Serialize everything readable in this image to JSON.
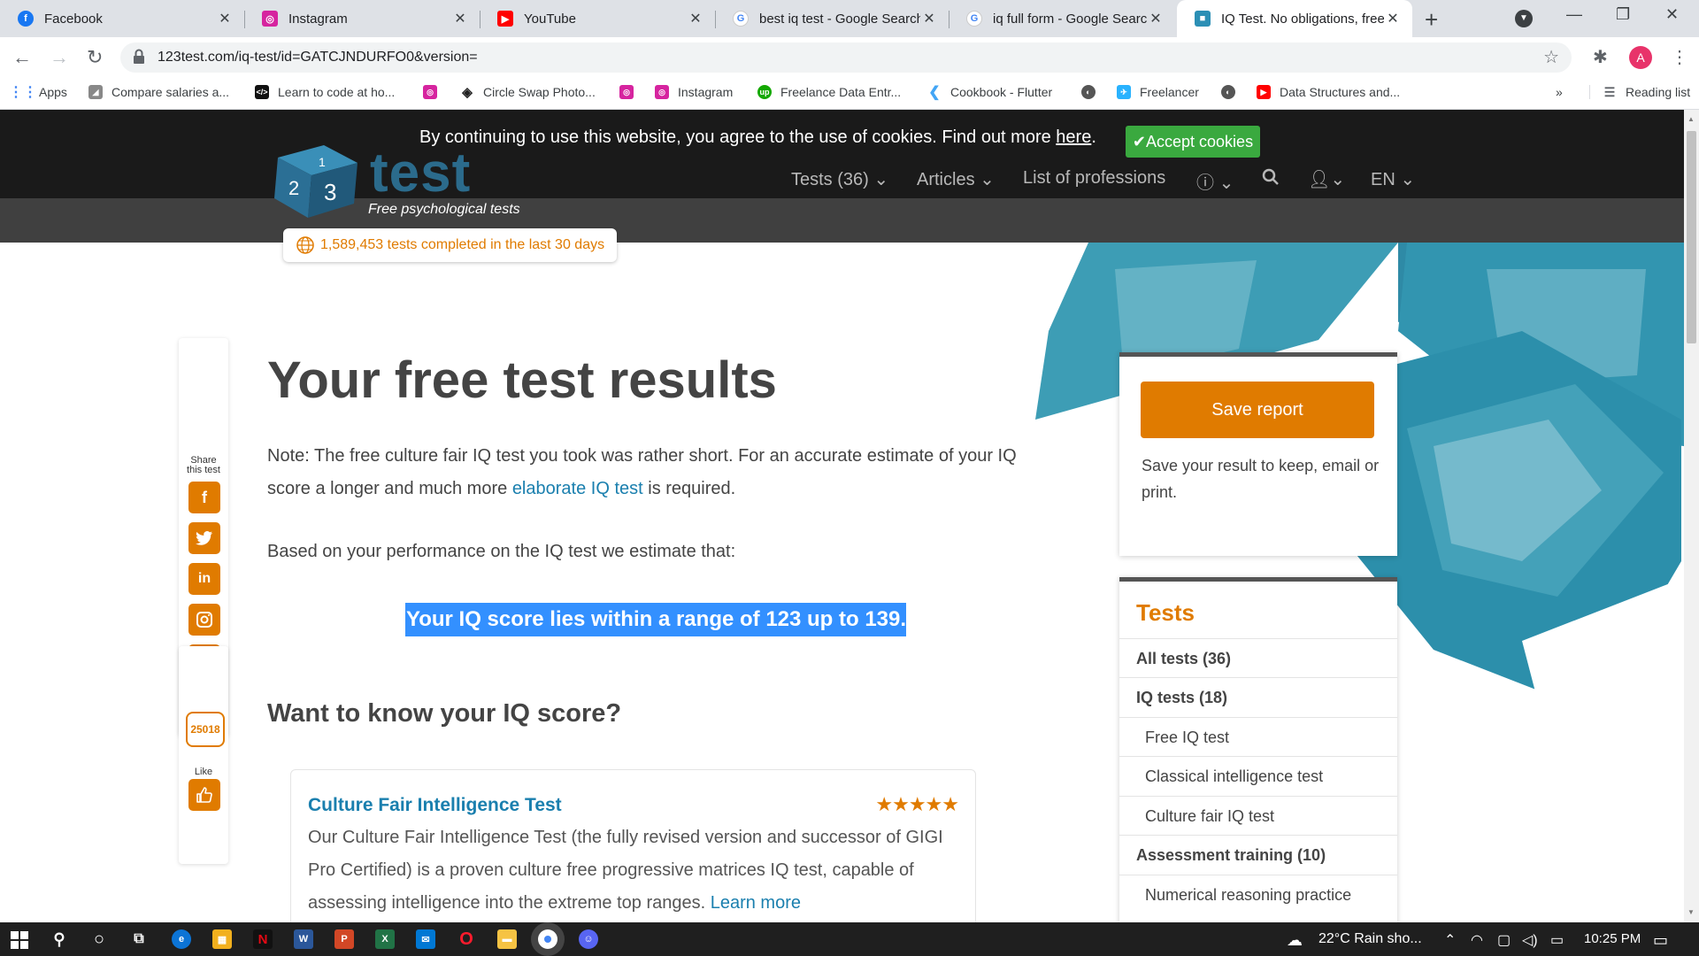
{
  "browser": {
    "tabs": [
      {
        "title": "Facebook",
        "favicon": "facebook-icon",
        "color": "#1877f2",
        "glyph": "f"
      },
      {
        "title": "Instagram",
        "favicon": "instagram-icon",
        "color": "#d6249f",
        "glyph": "◎"
      },
      {
        "title": "YouTube",
        "favicon": "youtube-icon",
        "color": "#ff0000",
        "glyph": "▶"
      },
      {
        "title": "best iq test - Google Search",
        "favicon": "google-icon",
        "color": "#4285f4",
        "glyph": "G"
      },
      {
        "title": "iq full form - Google Search",
        "favicon": "google-icon",
        "color": "#4285f4",
        "glyph": "G"
      },
      {
        "title": "IQ Test. No obligations, free",
        "favicon": "123test-icon",
        "color": "#2b8fb5",
        "glyph": "■"
      }
    ],
    "url": "123test.com/iq-test/id=GATCJNDURFO0&version=",
    "profile_initial": "A",
    "bookmarks": [
      {
        "label": "Apps",
        "icon": "apps-grid-icon"
      },
      {
        "label": "Compare salaries a...",
        "icon": "chart-icon"
      },
      {
        "label": "Learn to code at ho...",
        "icon": "code-icon"
      },
      {
        "label": "",
        "icon": "instagram-icon"
      },
      {
        "label": "Circle Swap Photo...",
        "icon": "codepen-icon"
      },
      {
        "label": "",
        "icon": "instagram-icon"
      },
      {
        "label": "Instagram",
        "icon": "instagram-icon"
      },
      {
        "label": "Freelance Data Entr...",
        "icon": "upwork-icon"
      },
      {
        "label": "Cookbook - Flutter",
        "icon": "flutter-icon"
      },
      {
        "label": "",
        "icon": "globe-icon"
      },
      {
        "label": "Freelancer",
        "icon": "freelancer-icon"
      },
      {
        "label": "",
        "icon": "globe-icon"
      },
      {
        "label": "Data Structures and...",
        "icon": "youtube-icon"
      }
    ],
    "more_bookmarks": "»",
    "reading_list": "Reading list"
  },
  "site": {
    "logo_text": "test",
    "logo_digits": "1 2 3",
    "tagline": "Free psychological tests",
    "cookie_text": "By continuing to use this website, you agree to the use of cookies. Find out more ",
    "cookie_link": "here",
    "accept_label": "✔Accept cookies",
    "nav": [
      "Tests (36)",
      "Articles",
      "List of professions"
    ],
    "lang": "EN",
    "counter": "1,589,453 tests completed in the last 30 days",
    "share_label_1": "Share",
    "share_label_2": "this test",
    "like_label": "Like",
    "like_count": "25018",
    "accent": "#e07b00",
    "link_color": "#1a7fae"
  },
  "main": {
    "title": "Your free test results",
    "note_pre": "Note: The free culture fair IQ test you took was rather short. For an accurate estimate of your IQ score a longer and much more ",
    "note_link": "elaborate IQ test",
    "note_post": " is required.",
    "based": "Based on your performance on the IQ test we estimate that:",
    "iq_result": "Your IQ score lies within a range of 123 up to 139.",
    "want_heading": "Want to know your IQ score?",
    "card": {
      "title": "Culture Fair Intelligence Test",
      "rating_stars": 5,
      "description": "Our Culture Fair Intelligence Test (the fully revised version and successor of GIGI Pro Certified) is a proven culture free progressive matrices IQ test, capable of assessing intelligence into the extreme top ranges. ",
      "learn_more": "Learn more"
    }
  },
  "sidebar": {
    "save_button": "Save report",
    "save_text": "Save your result to keep, email or print.",
    "tests_heading": "Tests",
    "tests": [
      {
        "label": "All tests (36)",
        "bold": true
      },
      {
        "label": "IQ tests (18)",
        "bold": true
      },
      {
        "label": "Free IQ test",
        "bold": false
      },
      {
        "label": "Classical intelligence test",
        "bold": false
      },
      {
        "label": "Culture fair IQ test",
        "bold": false
      },
      {
        "label": "Assessment training (10)",
        "bold": true
      },
      {
        "label": "Numerical reasoning practice",
        "bold": false
      }
    ]
  },
  "taskbar": {
    "weather": "22°C  Rain sho...",
    "time": "10:25 PM"
  }
}
